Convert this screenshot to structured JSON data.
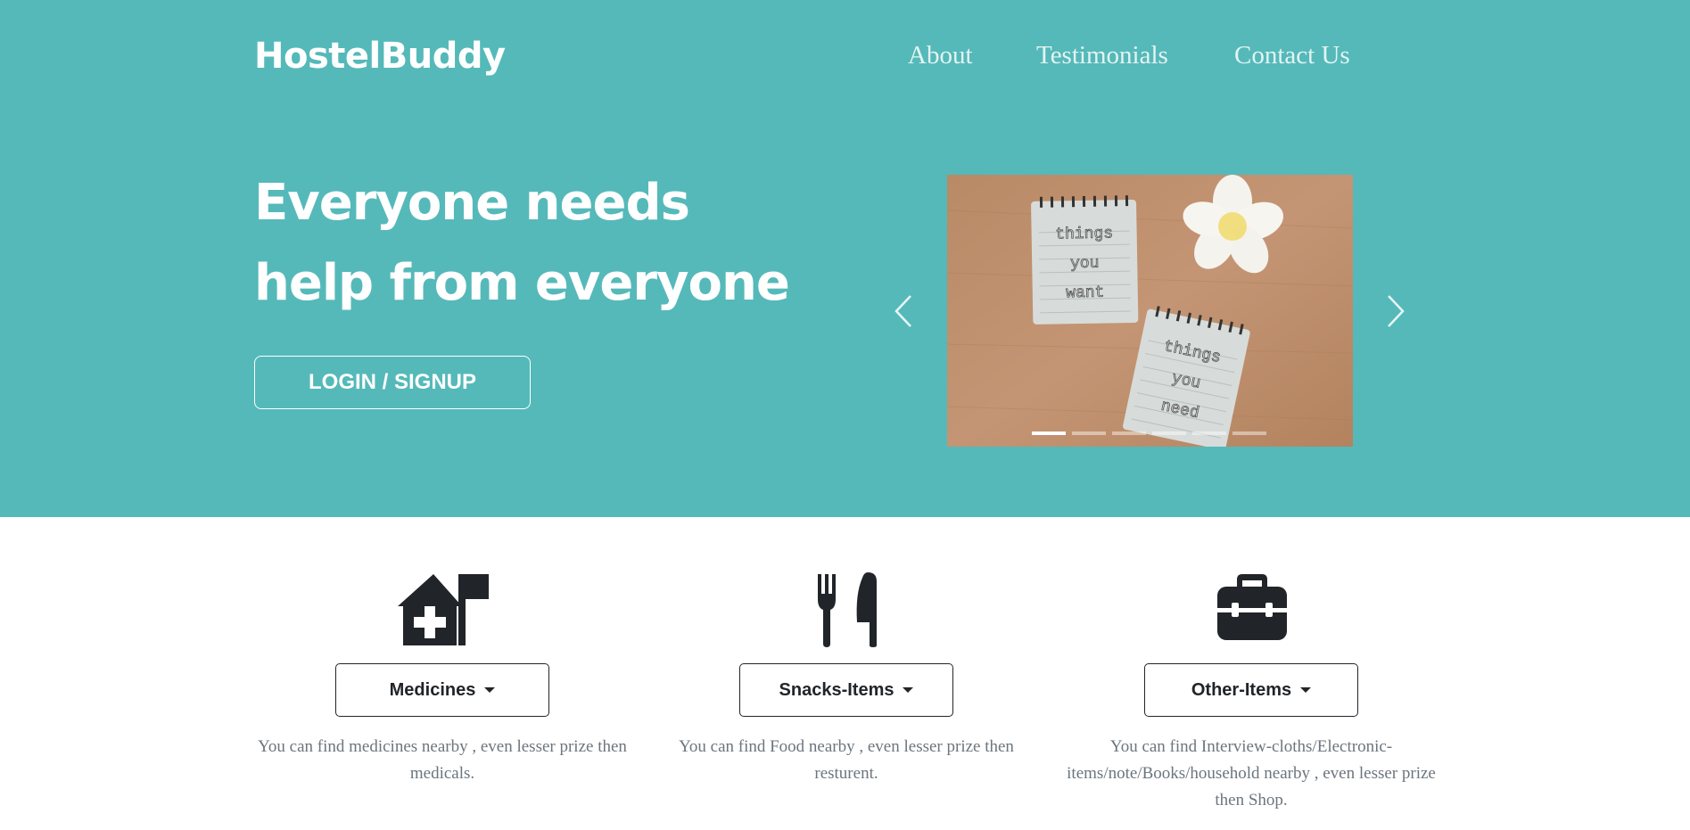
{
  "brand": "HostelBuddy",
  "nav": {
    "about": "About",
    "testimonials": "Testimonials",
    "contact": "Contact Us"
  },
  "hero": {
    "headline_line1": "Everyone needs",
    "headline_line2": "help from everyone",
    "login_button": "LOGIN / SIGNUP"
  },
  "carousel": {
    "slide_image": "notepads-things-you-want-things-you-need",
    "slide_text_1": "things you want",
    "slide_text_2": "things you need",
    "active_index": 0,
    "slide_count": 6
  },
  "features": [
    {
      "icon": "house-medical-flag-icon",
      "button": "Medicines",
      "description": "You can find medicines nearby , even lesser prize then medicals."
    },
    {
      "icon": "utensils-icon",
      "button": "Snacks-Items",
      "description": "You can find Food nearby , even lesser prize then resturent."
    },
    {
      "icon": "toolbox-icon",
      "button": "Other-Items",
      "description": "You can find Interview-cloths/Electronic-items/note/Books/household nearby , even lesser prize then Shop."
    }
  ],
  "colors": {
    "hero_bg": "#55b9b9",
    "text_dark": "#212529",
    "text_muted": "#6c757d"
  }
}
